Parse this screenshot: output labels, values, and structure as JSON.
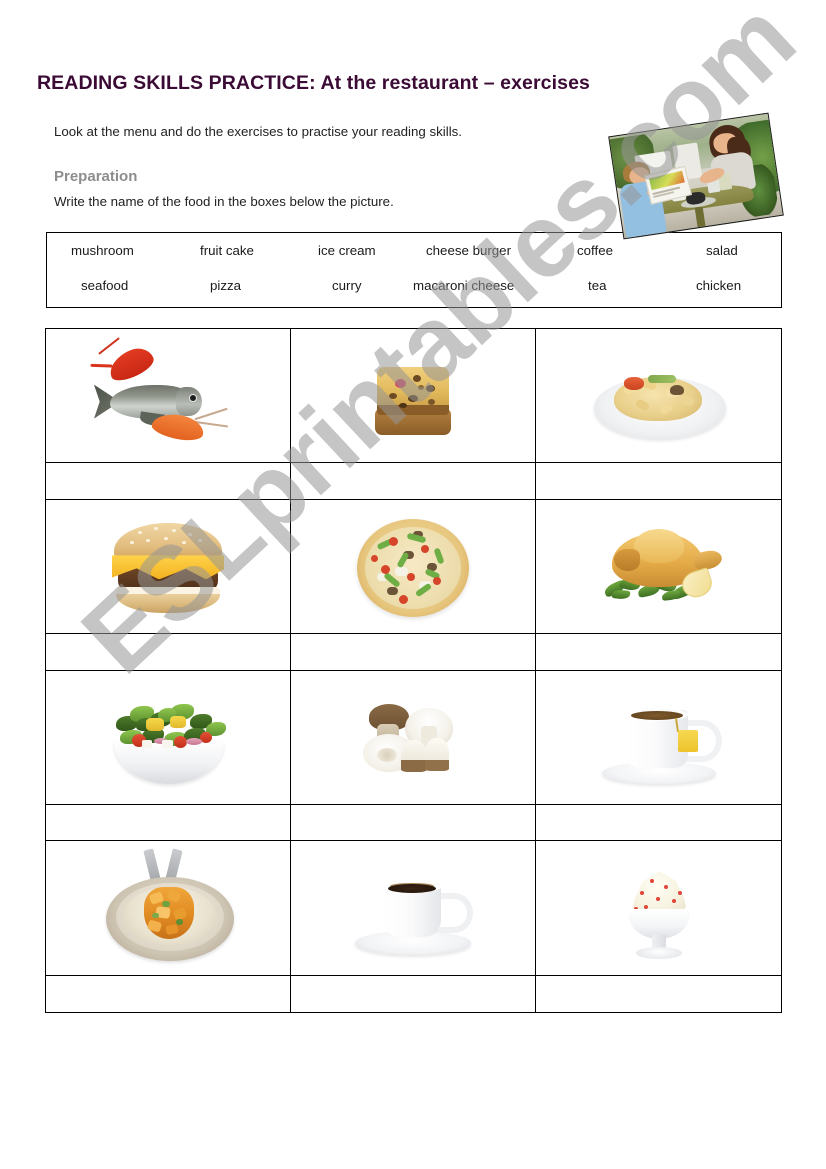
{
  "page": {
    "title": "READING SKILLS PRACTICE: At the restaurant – exercises",
    "intro": "Look at the menu and do the exercises to practise your reading skills.",
    "section_heading": "Preparation",
    "section_instruction": "Write the name of the food in the boxes below the picture.",
    "title_color": "#3b0a35",
    "heading_color": "#8d8d8d"
  },
  "watermark": {
    "text": "ESLprintables.com"
  },
  "photo": {
    "alt": "two people reading a menu at an outdoor restaurant table"
  },
  "word_bank": {
    "row1": [
      "mushroom",
      "fruit cake",
      "ice cream",
      "cheese burger",
      "coffee",
      "salad"
    ],
    "row2": [
      "seafood",
      "pizza",
      "curry",
      "macaroni cheese",
      "tea",
      "chicken"
    ]
  },
  "grid": {
    "rows": [
      {
        "pictures": [
          "seafood",
          "fruit cake",
          "macaroni cheese"
        ],
        "answers": [
          "",
          "",
          ""
        ]
      },
      {
        "pictures": [
          "cheese burger",
          "pizza",
          "chicken"
        ],
        "answers": [
          "",
          "",
          ""
        ]
      },
      {
        "pictures": [
          "salad",
          "mushroom",
          "tea"
        ],
        "answers": [
          "",
          "",
          ""
        ]
      },
      {
        "pictures": [
          "curry",
          "coffee",
          "ice cream"
        ],
        "answers": [
          "",
          "",
          ""
        ]
      }
    ]
  }
}
